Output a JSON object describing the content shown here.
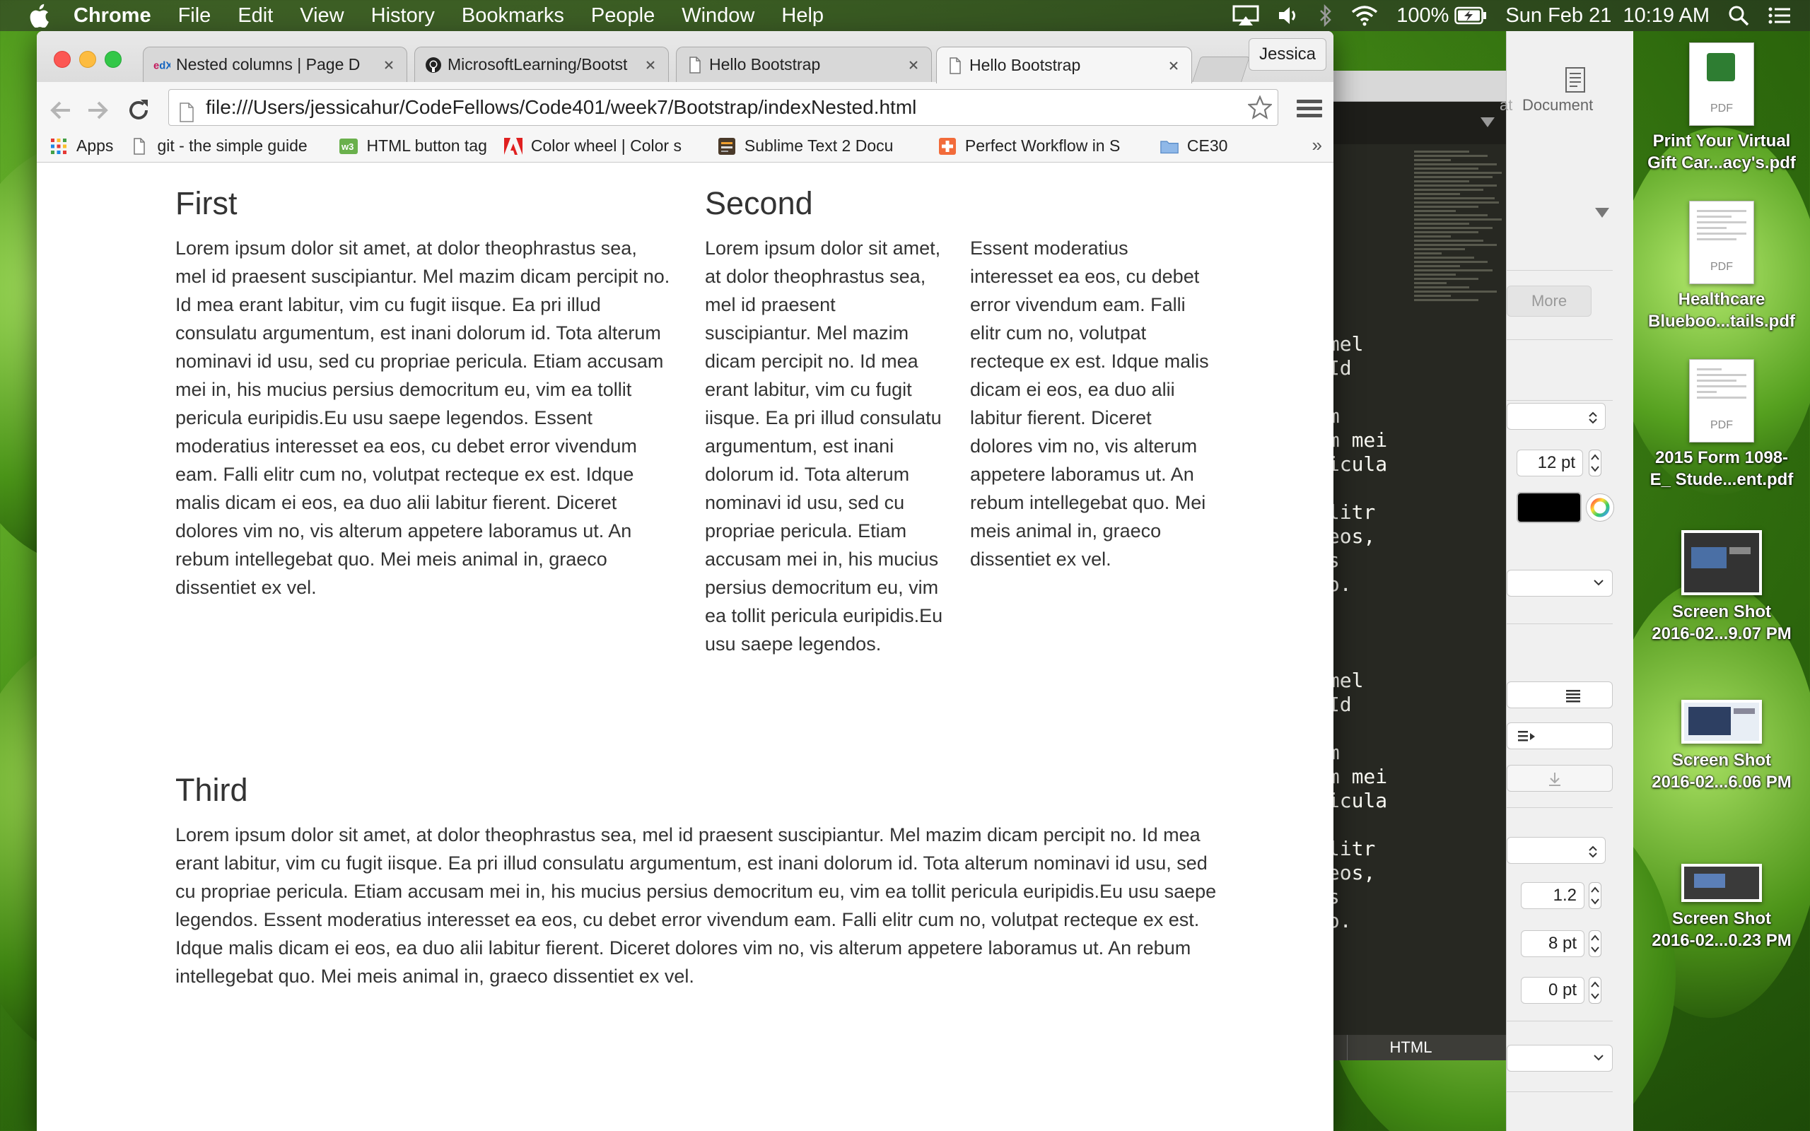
{
  "menubar": {
    "app_name": "Chrome",
    "items": [
      "File",
      "Edit",
      "View",
      "History",
      "Bookmarks",
      "People",
      "Window",
      "Help"
    ],
    "battery": "100%",
    "datetime": "Sun Feb 21  10:19 AM"
  },
  "browser": {
    "tabs": [
      {
        "title": "Nested columns | Page D",
        "icon": "edx-icon"
      },
      {
        "title": "MicrosoftLearning/Bootst",
        "icon": "github-icon"
      },
      {
        "title": "Hello Bootstrap",
        "icon": "page-icon"
      },
      {
        "title": "Hello Bootstrap",
        "icon": "page-icon",
        "active": true
      }
    ],
    "profile_name": "Jessica",
    "url": "file:///Users/jessicahur/CodeFellows/Code401/week7/Bootstrap/indexNested.html",
    "bookmarks": [
      {
        "label": "Apps",
        "icon": "apps-grid-icon"
      },
      {
        "label": "git - the simple guide",
        "icon": "page-icon"
      },
      {
        "label": "HTML button tag",
        "icon": "w3-icon"
      },
      {
        "label": "Color wheel | Color s",
        "icon": "adobe-icon"
      },
      {
        "label": "Sublime Text 2 Docu",
        "icon": "sublime-icon"
      },
      {
        "label": "Perfect Workflow in S",
        "icon": "plus-icon"
      },
      {
        "label": "CE30",
        "icon": "folder-icon"
      }
    ],
    "bookmarks_overflow": "»"
  },
  "page": {
    "first": {
      "heading": "First",
      "text": "Lorem ipsum dolor sit amet, at dolor theophrastus sea, mel id praesent suscipiantur. Mel mazim dicam percipit no. Id mea erant labitur, vim cu fugit iisque. Ea pri illud consulatu argumentum, est inani dolorum id. Tota alterum nominavi id usu, sed cu propriae pericula. Etiam accusam mei in, his mucius persius democritum eu, vim ea tollit pericula euripidis.Eu usu saepe legendos. Essent moderatius interesset ea eos, cu debet error vivendum eam. Falli elitr cum no, volutpat recteque ex est. Idque malis dicam ei eos, ea duo alii labitur fierent. Diceret dolores vim no, vis alterum appetere laboramus ut. An rebum intellegebat quo. Mei meis animal in, graeco dissentiet ex vel."
    },
    "second": {
      "heading": "Second",
      "left_text": "Lorem ipsum dolor sit amet, at dolor theophrastus sea, mel id praesent suscipiantur. Mel mazim dicam percipit no. Id mea erant labitur, vim cu fugit iisque. Ea pri illud consulatu argumentum, est inani dolorum id. Tota alterum nominavi id usu, sed cu propriae pericula. Etiam accusam mei in, his mucius persius democritum eu, vim ea tollit pericula euripidis.Eu usu saepe legendos.",
      "right_text": "Essent moderatius interesset ea eos, cu debet error vivendum eam. Falli elitr cum no, volutpat recteque ex est. Idque malis dicam ei eos, ea duo alii labitur fierent. Diceret dolores vim no, vis alterum appetere laboramus ut. An rebum intellegebat quo. Mei meis animal in, graeco dissentiet ex vel."
    },
    "third": {
      "heading": "Third",
      "text": "Lorem ipsum dolor sit amet, at dolor theophrastus sea, mel id praesent suscipiantur. Mel mazim dicam percipit no. Id mea erant labitur, vim cu fugit iisque. Ea pri illud consulatu argumentum, est inani dolorum id. Tota alterum nominavi id usu, sed cu propriae pericula. Etiam accusam mei in, his mucius persius democritum eu, vim ea tollit pericula euripidis.Eu usu saepe legendos. Essent moderatius interesset ea eos, cu debet error vivendum eam. Falli elitr cum no, volutpat recteque ex est. Idque malis dicam ei eos, ea duo alii labitur fierent. Diceret dolores vim no, vis alterum appetere laboramus ut. An rebum intellegebat quo. Mei meis animal in, graeco dissentiet ex vel."
    }
  },
  "editor": {
    "code_lines": [
      " mel",
      " Id",
      "",
      "um",
      "am mei",
      "ricula",
      "",
      "elitr",
      " eos,",
      "is",
      "uo.",
      "",
      "",
      "",
      " mel",
      " Id",
      "",
      "um",
      "am mei",
      "ricula",
      "",
      "elitr",
      " eos,",
      "is",
      "uo."
    ],
    "syntax": "HTML"
  },
  "inspector": {
    "format_label": "at",
    "document_label": "Document",
    "more_label": "More",
    "font_size": "12 pt",
    "line_spacing": "1.2",
    "before_paragraph": "8 pt",
    "after_paragraph": "0 pt",
    "text_color": "#000000"
  },
  "desktop_icons": [
    {
      "line1": "Print Your Virtual",
      "line2": "Gift Car...acy's.pdf",
      "kind": "pdf"
    },
    {
      "line1": "Healthcare",
      "line2": "Blueboo...tails.pdf",
      "kind": "pdf"
    },
    {
      "line1": "2015 Form 1098-",
      "line2": "E_ Stude...ent.pdf",
      "kind": "pdf"
    },
    {
      "line1": "Screen Shot",
      "line2": "2016-02...9.07 PM",
      "kind": "screenshot"
    },
    {
      "line1": "Screen Shot",
      "line2": "2016-02...6.06 PM",
      "kind": "screenshot"
    },
    {
      "line1": "Screen Shot",
      "line2": "2016-02...0.23 PM",
      "kind": "screenshot"
    }
  ],
  "pdf_tag": "PDF"
}
